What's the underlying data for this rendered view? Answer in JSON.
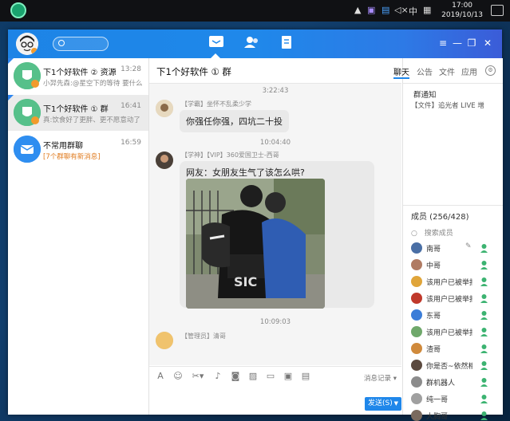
{
  "taskbar": {
    "tray_ime": "中",
    "time": "17:00",
    "date": "2019/10/13"
  },
  "topbar": {
    "nav": [
      "messages-icon",
      "contacts-icon",
      "notes-icon"
    ],
    "window_buttons": [
      "≡",
      "—",
      "❐",
      "✕"
    ]
  },
  "conversations": [
    {
      "name": "下1个好软件 ② 资源",
      "time": "13:28",
      "preview": "小羿先森:@星空下的等待 要什么",
      "orange": false
    },
    {
      "name": "下1个好软件 ① 群",
      "time": "16:41",
      "preview": "真:饮食好了更胖、更不愿意动了",
      "orange": false
    },
    {
      "name": "不常用群聊",
      "time": "16:59",
      "preview": "[7个群聊有新消息]",
      "orange": true
    }
  ],
  "chat": {
    "title": "下1个好软件 ① 群",
    "messages": {
      "ts1": "3:22:43",
      "sender1": "【学霸】坐怀不乱柔少学",
      "text1": "你强任你强，四坑二十投",
      "ts2": "10:04:40",
      "sender2": "【学神】【VIP】360爱国卫士-西哥",
      "text2": "网友：女朋友生气了该怎么哄?",
      "ts3": "10:09:03",
      "sender3": "【管理员】清哥"
    },
    "toolbar": {
      "history": "消息记录",
      "send": "发送(S)"
    }
  },
  "rightpane": {
    "tabs": [
      "聊天",
      "公告",
      "文件",
      "应用"
    ],
    "notice_title": "群通知",
    "notice_body": "【文件】追光者 LIVE 增",
    "members_title": "成员 (256/428)",
    "member_search": "搜索成员",
    "members": [
      {
        "name": "南哥",
        "color": "#4a6fa5"
      },
      {
        "name": "中哥",
        "color": "#b07b63"
      },
      {
        "name": "该用户已被举报",
        "color": "#e0a53a"
      },
      {
        "name": "该用户已被举报",
        "color": "#c0392b"
      },
      {
        "name": "东哥",
        "color": "#3b7dd8"
      },
      {
        "name": "该用户已被举报",
        "color": "#6fa86b"
      },
      {
        "name": "渣哥",
        "color": "#d08a3c"
      },
      {
        "name": "你是否~依然相",
        "color": "#5b4a3f"
      },
      {
        "name": "群机器人",
        "color": "#8c8c8c"
      },
      {
        "name": "纯一哥",
        "color": "#a0a0a0"
      },
      {
        "name": "大胸哥",
        "color": "#7a6a5e"
      }
    ]
  },
  "colors": {
    "brand": "#1f87ea",
    "accent_orange": "#e07b1e"
  }
}
